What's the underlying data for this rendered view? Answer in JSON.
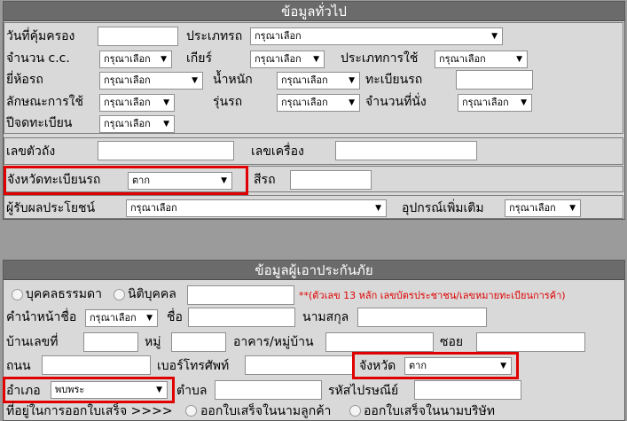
{
  "general": {
    "title": "ข้อมูลทั่วไป",
    "labels": {
      "protect_date": "วันที่คุ้มครอง",
      "car_type": "ประเภทรถ",
      "cc": "จำนวน c.c.",
      "gear": "เกียร์",
      "usage_type": "ประเภทการใช้",
      "brand": "ยี่ห้อรถ",
      "weight": "น้ำหนัก",
      "plate": "ทะเบียนรถ",
      "usage_style": "ลักษณะการใช้",
      "model": "รุ่นรถ",
      "seats": "จำนวนที่นั่ง",
      "reg_year": "ปีจดทะเบียน",
      "chassis": "เลขตัวถัง",
      "engine": "เลขเครื่อง",
      "province": "จังหวัดทะเบียนรถ",
      "color": "สีรถ",
      "beneficiary": "ผู้รับผลประโยชน์",
      "accessories": "อุปกรณ์เพิ่มเติม"
    },
    "select_default": "กรุณาเลือก",
    "province_value": "ตาก"
  },
  "insured": {
    "title": "ข้อมูลผู้เอาประกันภัย",
    "person_type_options": [
      "บุคคลธรรมดา",
      "นิติบุคคล"
    ],
    "id_note": "**(ตัวเลข 13 หลัก เลขบัตรประชาชน/เลขหมายทะเบียนการค้า)",
    "labels": {
      "prefix": "คำนำหน้าชื่อ",
      "first_name": "ชื่อ",
      "last_name": "นามสกุล",
      "house_no": "บ้านเลขที่",
      "moo": "หมู่",
      "building": "อาคาร/หมู่บ้าน",
      "soi": "ซอย",
      "road": "ถนน",
      "phone": "เบอร์โทรศัพท์",
      "province": "จังหวัด",
      "district": "อำเภอ",
      "subdistrict": "ตำบล",
      "postcode": "รหัสไปรษณีย์",
      "receipt_address": "ที่อยู่ในการออกใบเสร็จ >>>>",
      "receipt_customer": "ออกใบเสร็จในนามลูกค้า",
      "receipt_company": "ออกใบเสร็จในนามบริษัท"
    },
    "prefix_value": "กรุณาเลือก",
    "province_value": "ตาก",
    "district_value": "พบพระ"
  },
  "icons": {
    "dropdown": "chevron-down-icon",
    "radio": "radio-icon"
  },
  "colors": {
    "highlight": "#e00000",
    "note": "#e00000",
    "header_bg": "#6b6b6b",
    "panel_bg": "#d9d9d9",
    "page_bg": "#9b9b9b"
  }
}
